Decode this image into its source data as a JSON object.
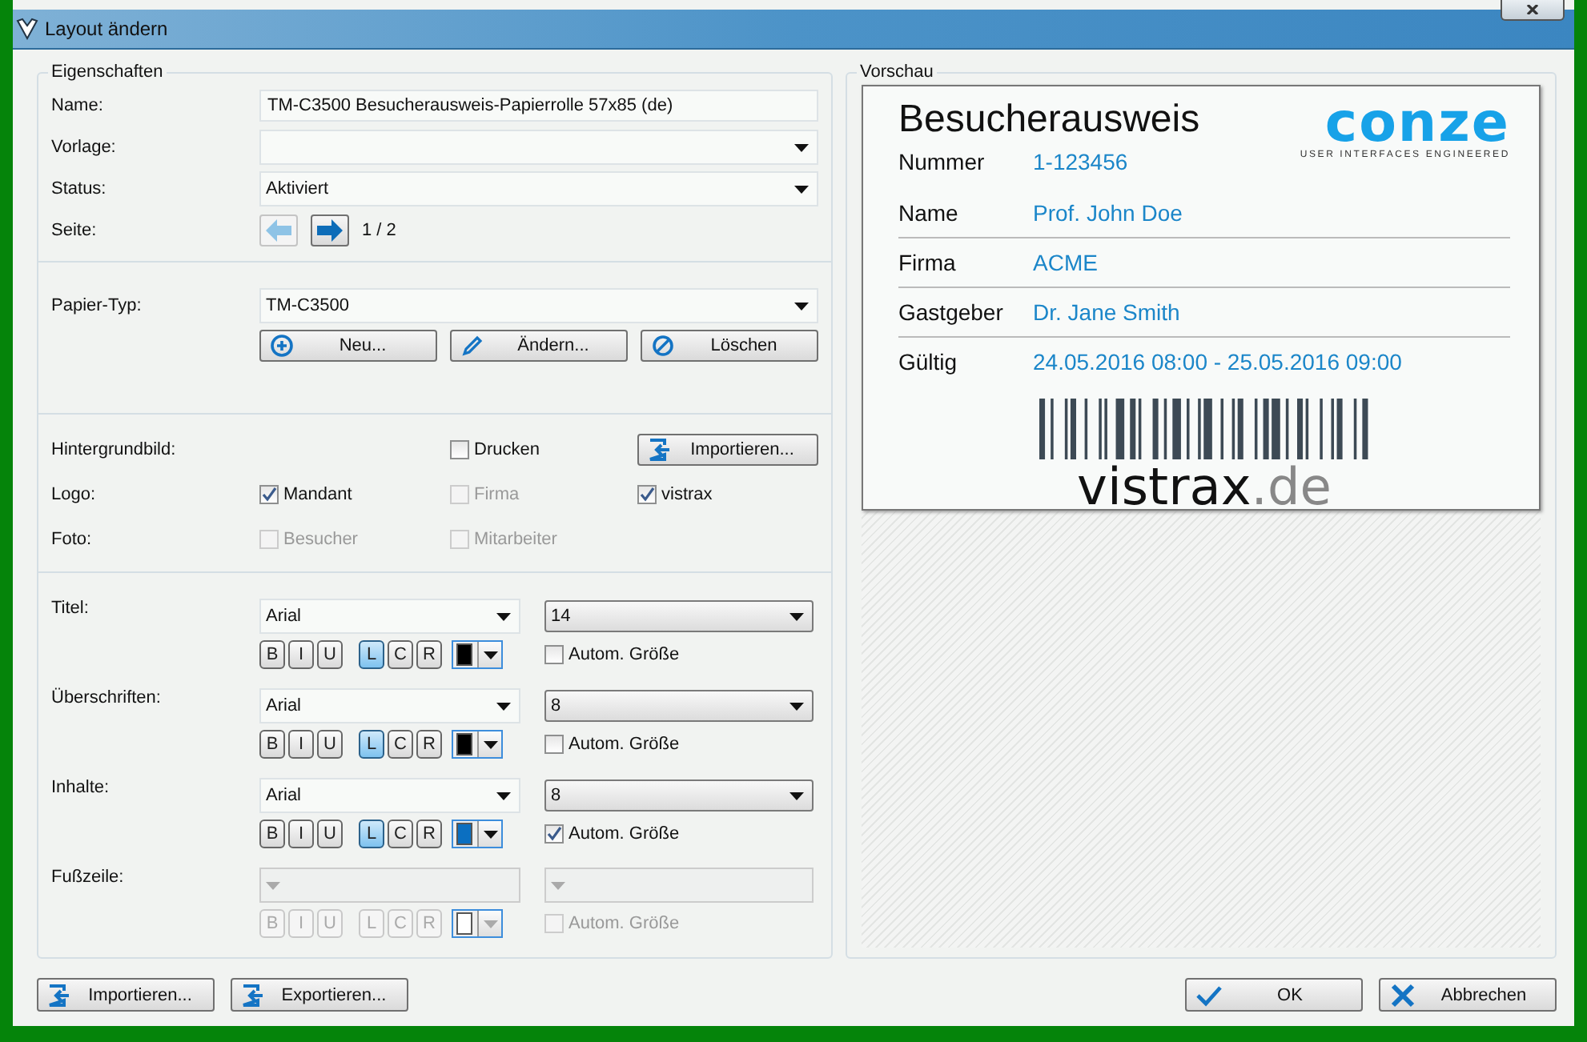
{
  "window": {
    "title": "Layout ändern"
  },
  "properties": {
    "legend": "Eigenschaften",
    "name": {
      "label": "Name:",
      "value": "TM-C3500 Besucherausweis-Papierrolle 57x85 (de)"
    },
    "template": {
      "label": "Vorlage:"
    },
    "status": {
      "label": "Status:",
      "value": "Aktiviert"
    },
    "page": {
      "label": "Seite:",
      "indicator": "1 / 2",
      "prev_disabled": true,
      "next_disabled": false
    },
    "paper": {
      "label": "Papier-Typ:",
      "value": "TM-C3500",
      "buttons": [
        {
          "label": "Neu...",
          "kind": "add"
        },
        {
          "label": "Ändern...",
          "kind": "edit"
        },
        {
          "label": "Löschen",
          "kind": "delete"
        }
      ]
    },
    "background": {
      "label": "Hintergrundbild:",
      "print": {
        "label": "Drucken",
        "checked": false,
        "disabled": false
      },
      "import_button": "Importieren..."
    },
    "logo": {
      "label": "Logo:",
      "options": [
        {
          "label": "Mandant",
          "checked": true,
          "disabled": false
        },
        {
          "label": "Firma",
          "checked": false,
          "disabled": true
        },
        {
          "label": "vistrax",
          "checked": true,
          "disabled": false
        }
      ]
    },
    "photo": {
      "label": "Foto:",
      "options": [
        {
          "label": "Besucher",
          "checked": false,
          "disabled": true
        },
        {
          "label": "Mitarbeiter",
          "checked": false,
          "disabled": true
        }
      ]
    },
    "fonts": [
      {
        "label": "Titel:",
        "font": "Arial",
        "size": "14",
        "disabled": false,
        "styles": [
          {
            "label": "B",
            "selected": false
          },
          {
            "label": "I",
            "selected": false
          },
          {
            "label": "U",
            "selected": false
          }
        ],
        "align": [
          {
            "label": "L",
            "selected": true
          },
          {
            "label": "C",
            "selected": false
          },
          {
            "label": "R",
            "selected": false
          }
        ],
        "color": "#000000",
        "auto_size": {
          "label": "Autom. Größe",
          "checked": false
        }
      },
      {
        "label": "Überschriften:",
        "font": "Arial",
        "size": "8",
        "disabled": false,
        "styles": [
          {
            "label": "B",
            "selected": false
          },
          {
            "label": "I",
            "selected": false
          },
          {
            "label": "U",
            "selected": false
          }
        ],
        "align": [
          {
            "label": "L",
            "selected": true
          },
          {
            "label": "C",
            "selected": false
          },
          {
            "label": "R",
            "selected": false
          }
        ],
        "color": "#000000",
        "auto_size": {
          "label": "Autom. Größe",
          "checked": false
        }
      },
      {
        "label": "Inhalte:",
        "font": "Arial",
        "size": "8",
        "disabled": false,
        "styles": [
          {
            "label": "B",
            "selected": false
          },
          {
            "label": "I",
            "selected": false
          },
          {
            "label": "U",
            "selected": false
          }
        ],
        "align": [
          {
            "label": "L",
            "selected": true
          },
          {
            "label": "C",
            "selected": false
          },
          {
            "label": "R",
            "selected": false
          }
        ],
        "color": "#0b6fc1",
        "auto_size": {
          "label": "Autom. Größe",
          "checked": true
        }
      },
      {
        "label": "Fußzeile:",
        "disabled": true,
        "styles": [
          {
            "label": "B",
            "selected": false
          },
          {
            "label": "I",
            "selected": false
          },
          {
            "label": "U",
            "selected": false
          }
        ],
        "align": [
          {
            "label": "L",
            "selected": false
          },
          {
            "label": "C",
            "selected": false
          },
          {
            "label": "R",
            "selected": false
          }
        ],
        "color": "#ffffff",
        "auto_size": {
          "label": "Autom. Größe",
          "checked": false
        }
      }
    ]
  },
  "preview": {
    "legend": "Vorschau",
    "card": {
      "title": "Besucherausweis",
      "logo": "conze",
      "tagline": "USER INTERFACES ENGINEERED",
      "rows": [
        {
          "label": "Nummer",
          "value": "1-123456"
        },
        {
          "label": "Name",
          "value": "Prof. John Doe"
        },
        {
          "label": "Firma",
          "value": "ACME"
        },
        {
          "label": "Gastgeber",
          "value": "Dr. Jane Smith"
        },
        {
          "label": "Gültig",
          "value": "24.05.2016 08:00 - 25.05.2016 09:00"
        }
      ],
      "footer": "vistrax",
      "footer_suffix": ".de"
    }
  },
  "file_buttons": [
    {
      "label": "Importieren...",
      "kind": "import"
    },
    {
      "label": "Exportieren...",
      "kind": "import"
    }
  ],
  "dialog_buttons": [
    {
      "label": "OK",
      "kind": "check"
    },
    {
      "label": "Abbrechen",
      "kind": "cross"
    }
  ]
}
